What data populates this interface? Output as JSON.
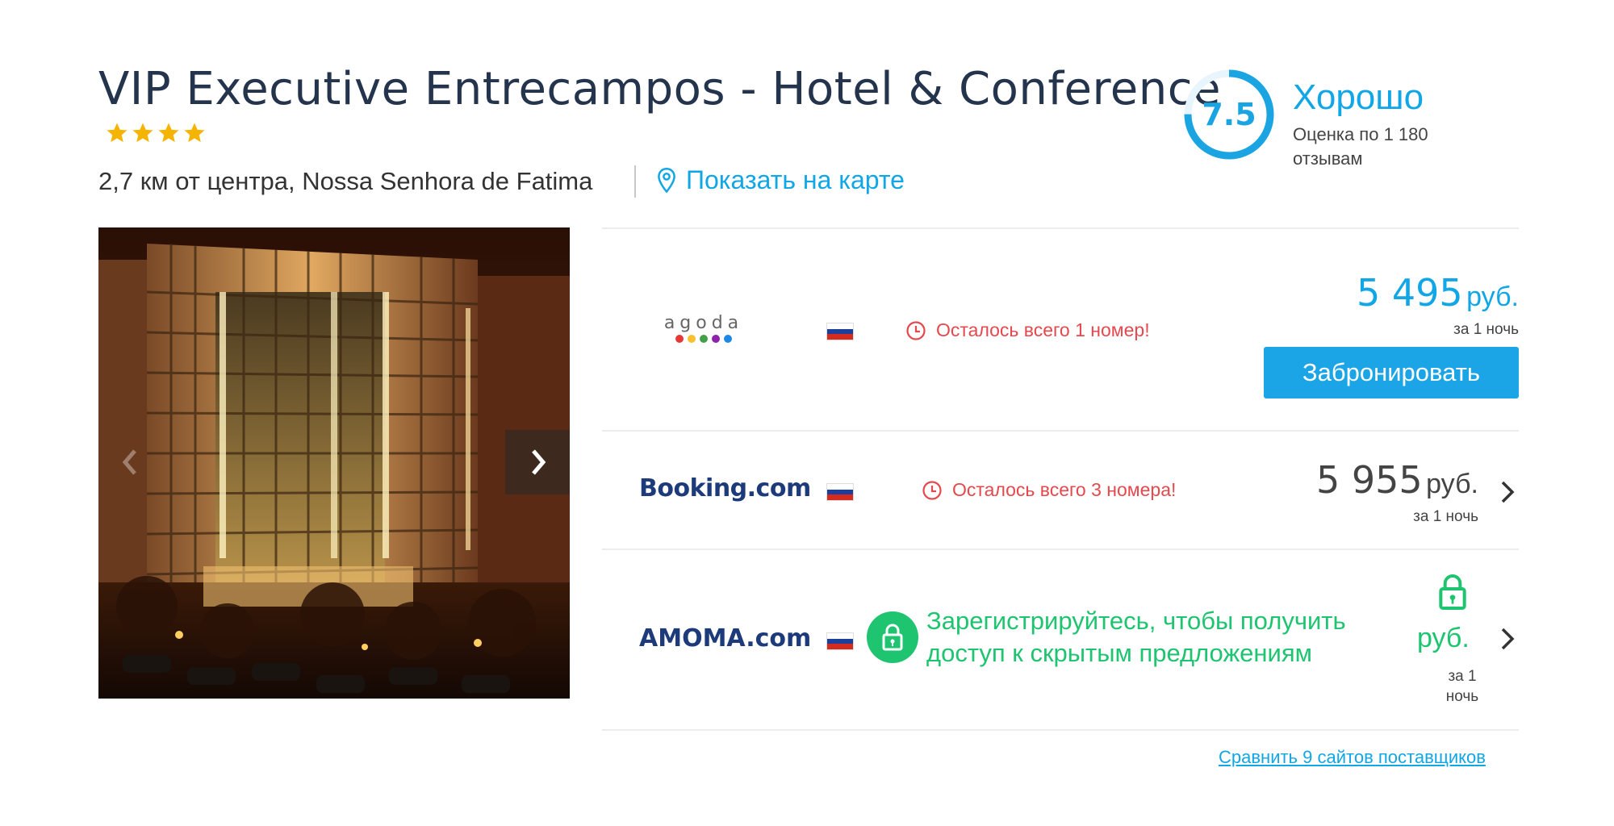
{
  "hotel": {
    "name": "VIP Executive Entrecampos - Hotel & Conference",
    "stars": 4,
    "location": "2,7 км от центра, Nossa Senhora de Fatima",
    "map_link": "Показать на карте"
  },
  "rating": {
    "score": "7.5",
    "fraction": 0.75,
    "label": "Хорошо",
    "reviews": "Оценка по 1 180 отзывам"
  },
  "gallery": {
    "prev_icon": "chevron-left-icon",
    "next_icon": "chevron-right-icon"
  },
  "offers": [
    {
      "provider": "agoda",
      "urgency": "Осталось всего 1 номер!",
      "price": "5 495",
      "currency": "руб.",
      "per_night": "за 1 ночь",
      "button": "Забронировать"
    },
    {
      "provider": "Booking.com",
      "urgency": "Осталось всего 3 номера!",
      "price": "5 955",
      "currency": "руб.",
      "per_night": "за 1 ночь"
    },
    {
      "provider": "AMOMA.com",
      "promo": "Зарегистрируйтесь, чтобы получить доступ к скрытым предложениям",
      "currency": "руб.",
      "per_night": "за 1 ночь"
    }
  ],
  "compare_link": "Сравнить 9 сайтов поставщиков",
  "colors": {
    "accent": "#11a6e6",
    "title": "#24344d",
    "urgent": "#e5484d",
    "promo_green": "#1ec46f",
    "star": "#f5b400"
  }
}
